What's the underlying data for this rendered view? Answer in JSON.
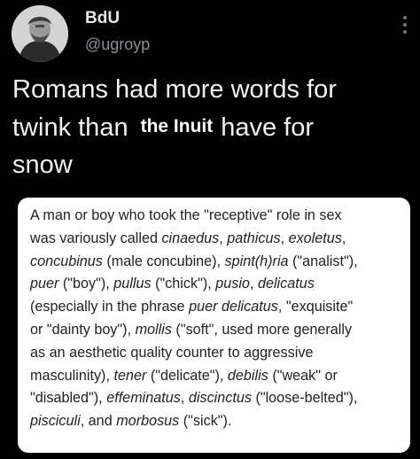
{
  "author": {
    "display_name": "BdU",
    "handle": "@ugroyp"
  },
  "tweet": {
    "line1": "Romans had more words for",
    "line2_start": "twink than",
    "line2_overlay": "the Inuit",
    "line2_end": "have for",
    "line3": "snow"
  },
  "quote": {
    "lines": [
      [
        {
          "t": "A man or boy who took the \"receptive\" role in sex",
          "i": false
        }
      ],
      [
        {
          "t": "was variously called ",
          "i": false
        },
        {
          "t": "cinaedus",
          "i": true
        },
        {
          "t": ", ",
          "i": false
        },
        {
          "t": "pathicus",
          "i": true
        },
        {
          "t": ", ",
          "i": false
        },
        {
          "t": "exoletus",
          "i": true
        },
        {
          "t": ",",
          "i": false
        }
      ],
      [
        {
          "t": "concubinus",
          "i": true
        },
        {
          "t": " (male concubine), ",
          "i": false
        },
        {
          "t": "spint(h)ria",
          "i": true
        },
        {
          "t": " (\"analist\"),",
          "i": false
        }
      ],
      [
        {
          "t": "puer",
          "i": true
        },
        {
          "t": " (\"boy\"), ",
          "i": false
        },
        {
          "t": "pullus",
          "i": true
        },
        {
          "t": " (\"chick\"), ",
          "i": false
        },
        {
          "t": "pusio",
          "i": true
        },
        {
          "t": ", ",
          "i": false
        },
        {
          "t": "delicatus",
          "i": true
        }
      ],
      [
        {
          "t": "(especially in the phrase ",
          "i": false
        },
        {
          "t": "puer delicatus",
          "i": true
        },
        {
          "t": ", \"exquisite\"",
          "i": false
        }
      ],
      [
        {
          "t": "or \"dainty boy\"), ",
          "i": false
        },
        {
          "t": "mollis",
          "i": true
        },
        {
          "t": " (\"soft\", used more generally",
          "i": false
        }
      ],
      [
        {
          "t": "as an aesthetic quality counter to aggressive",
          "i": false
        }
      ],
      [
        {
          "t": "masculinity), ",
          "i": false
        },
        {
          "t": "tener",
          "i": true
        },
        {
          "t": " (\"delicate\"), ",
          "i": false
        },
        {
          "t": "debilis",
          "i": true
        },
        {
          "t": " (\"weak\" or",
          "i": false
        }
      ],
      [
        {
          "t": "\"disabled\"), ",
          "i": false
        },
        {
          "t": "effeminatus",
          "i": true
        },
        {
          "t": ", ",
          "i": false
        },
        {
          "t": "discinctus",
          "i": true
        },
        {
          "t": " (\"loose-belted\"),",
          "i": false
        }
      ],
      [
        {
          "t": "pisciculi",
          "i": true
        },
        {
          "t": ", and ",
          "i": false
        },
        {
          "t": "morbosus",
          "i": true
        },
        {
          "t": " (\"sick\").",
          "i": false
        }
      ]
    ]
  },
  "icons": {
    "avatar": "avatar-portrait",
    "more": "more-vertical-icon"
  }
}
